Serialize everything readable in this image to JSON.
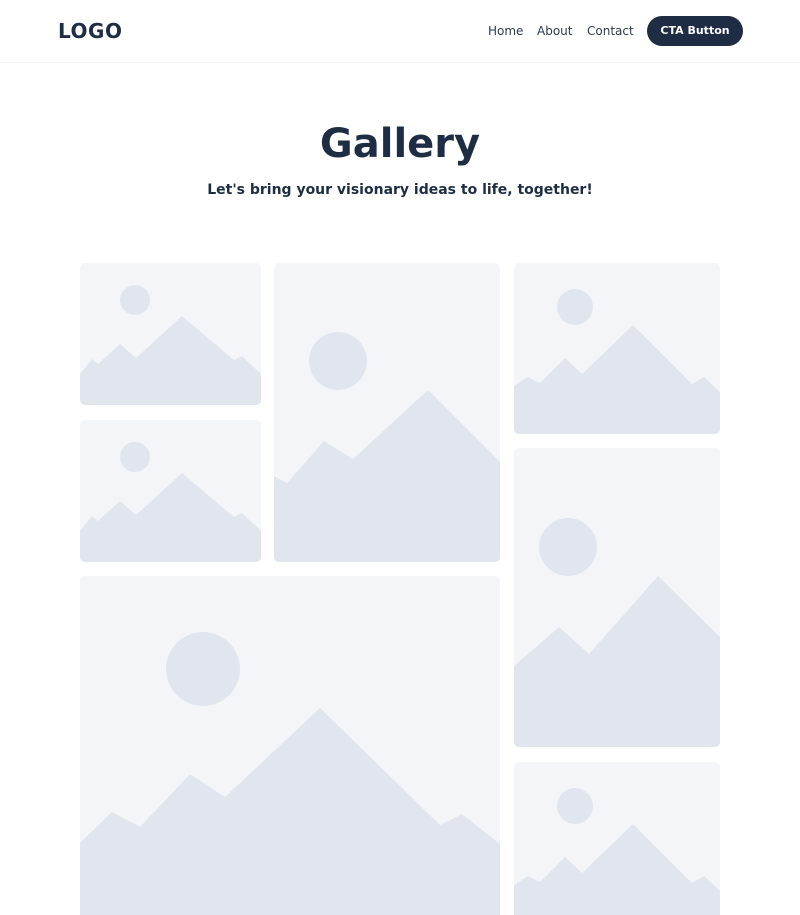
{
  "header": {
    "logo": "LOGO",
    "nav": [
      {
        "label": "Home"
      },
      {
        "label": "About"
      },
      {
        "label": "Contact"
      }
    ],
    "cta_label": "CTA Button"
  },
  "hero": {
    "title": "Gallery",
    "subtitle": "Let's bring your visionary ideas to life, together!"
  },
  "gallery": {
    "image_count": 7,
    "placeholder_icon": "image-placeholder-icon"
  },
  "colors": {
    "primary": "#1f2d44",
    "tile_background": "#f4f5f9",
    "placeholder_shape": "#e1e6ee"
  }
}
